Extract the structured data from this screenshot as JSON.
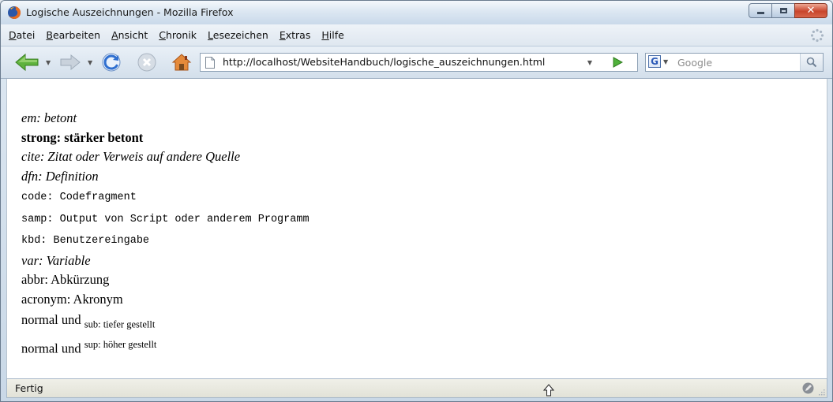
{
  "window": {
    "title": "Logische Auszeichnungen - Mozilla Firefox"
  },
  "menu": {
    "items": [
      {
        "first": "D",
        "rest": "atei"
      },
      {
        "first": "B",
        "rest": "earbeiten"
      },
      {
        "first": "A",
        "rest": "nsicht"
      },
      {
        "first": "C",
        "rest": "hronik"
      },
      {
        "first": "L",
        "rest": "esezeichen"
      },
      {
        "first": "E",
        "rest": "xtras"
      },
      {
        "first": "H",
        "rest": "ilfe"
      }
    ]
  },
  "toolbar": {
    "url": "http://localhost/WebsiteHandbuch/logische_auszeichnungen.html",
    "search_engine_letter": "G",
    "search_placeholder": "Google"
  },
  "content": {
    "em": "em: betont",
    "strong": "strong: stärker betont",
    "cite": "cite: Zitat oder Verweis auf andere Quelle",
    "dfn": "dfn: Definition",
    "code": "code: Codefragment",
    "samp": "samp: Output von Script oder anderem Programm",
    "kbd": "kbd: Benutzereingabe",
    "var": "var: Variable",
    "abbr": "abbr: Abkürzung",
    "acronym": "acronym: Akronym",
    "normal_sub": "normal und",
    "sub": "sub: tiefer gestellt",
    "normal_sup": "normal und",
    "sup": "sup: höher gestellt"
  },
  "status": {
    "text": "Fertig"
  },
  "colors": {
    "close_button": "#c8452c",
    "chrome": "#dfe9f3",
    "content_bg": "#ffffff"
  },
  "icons": {
    "title": "firefox-icon",
    "back": "back-arrow-icon",
    "forward": "forward-arrow-icon",
    "reload": "reload-icon",
    "stop": "stop-icon",
    "home": "home-icon",
    "page": "page-icon",
    "go": "go-arrow-icon",
    "search": "magnifier-icon",
    "status": "pencil-icon"
  }
}
